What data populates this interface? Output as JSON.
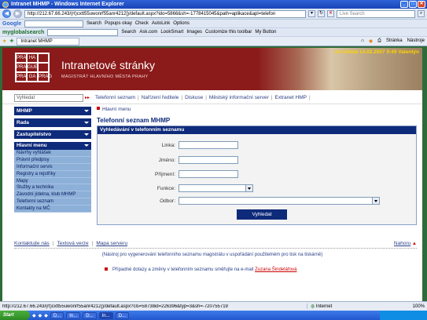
{
  "window": {
    "title": "Intranet MHMP - Windows Internet Explorer"
  },
  "browser": {
    "address": "http://212.67.66.243/(rt)cxtt55uwonrf55anr4212])/default.aspx?ido=5866&sh=-1778415045&path=aplikace&apl=telefon",
    "live_search_placeholder": "Live Search",
    "google_label": "Google",
    "google_search_btn": "Search",
    "popups": "Popups okay",
    "check": "Check",
    "autolink": "AutoLink",
    "options": "Options",
    "mgs_logo": "myglobalsearch",
    "mgs_search": "Search",
    "mgs_links": [
      "Ask.com",
      "LookSmart",
      "Images",
      "Customize this toolbar",
      "My Button"
    ],
    "tab_label": "Intranet MHMP",
    "stranka": "Stránka",
    "nastroje": "Nástroje"
  },
  "banner": {
    "logo_cells": [
      "PRA",
      "HA",
      "",
      "PRA",
      "GUE",
      "",
      "PRA",
      "GA",
      "PRAG"
    ],
    "title": "Intranetové stránky",
    "subtitle": "MAGISTRÁT HLAVNÍHO MĚSTA PRAHY",
    "date": "txt  středa 14.02.2007 9:49 Valentýn"
  },
  "search": {
    "placeholder": "Vyhledat",
    "arrows": "▸▸"
  },
  "toplinks": [
    "Telefonní seznam",
    "Nařízení ředitele",
    "Diskuse",
    "Městský informační server",
    "Extranet HMP"
  ],
  "sidebar": {
    "selects": [
      "MHMP",
      "Rada",
      "Zastupitelstvo"
    ],
    "menu_head": "Hlavní menu",
    "menu": [
      "Návrhy vyhlášek",
      "Právní předpisy",
      "Informační servis",
      "Registry a rejstříky",
      "Mapy",
      "Služby a technika",
      "Závodní jídelna, klub MHMP",
      "Telefonní seznam",
      "Kontakty na MČ"
    ]
  },
  "main": {
    "crumb": "Hlavní menu",
    "title": "Telefonní seznam MHMP",
    "form_head": "Vyhledávání v telefonním seznamu",
    "labels": {
      "linka": "Linka:",
      "jmeno": "Jméno:",
      "prijmeni": "Příjmení:",
      "funkce": "Funkce:",
      "odbor": "Odbor:"
    },
    "submit": "Vyhledat"
  },
  "footer": {
    "links": [
      "Kontaktujte nás",
      "Textová verze",
      "Mapa serveru"
    ],
    "nahoru": "Nahoru",
    "note": "(Nástroj pro vygenerování telefonního seznamu magistrátu v uspořádání použitelném pro tisk na tiskárně)",
    "contact_text": "Případné dotazy a změny v telefonním seznamu směřujte na e-mail ",
    "contact_name": "Zuzana Šindelářová"
  },
  "status": {
    "url": "http://212.67.66.243/(rt)cxtt55uwonrf55anr4212])/default.aspx?cls=58738id=226396&typ=3&sh=-720755719",
    "zone": "Internet",
    "zoom": "100%"
  },
  "taskbar": {
    "start": "Start",
    "tasks": [
      "D...",
      "In...",
      "D...",
      "In...",
      "D..."
    ]
  },
  "colors": {
    "navy": "#0e2a7a",
    "maroon": "#8b1a1a",
    "link": "#2a3f86",
    "accent_red": "#cc0000",
    "menu_bg": "#8db0d9"
  }
}
